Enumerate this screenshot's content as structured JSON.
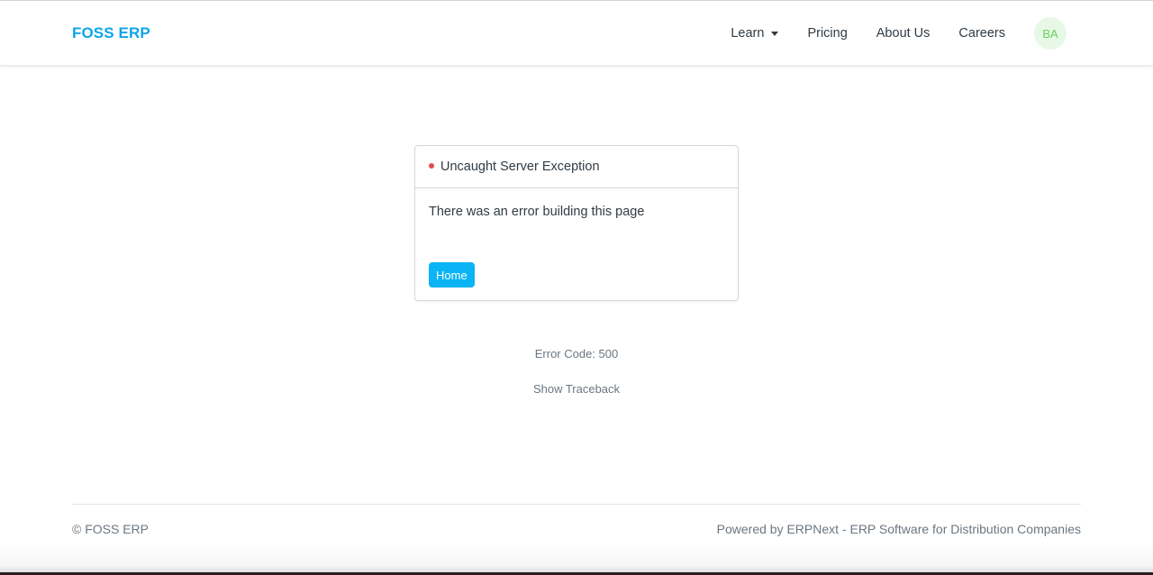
{
  "navbar": {
    "brand": "FOSS ERP",
    "links": [
      {
        "label": "Learn",
        "dropdown": true
      },
      {
        "label": "Pricing"
      },
      {
        "label": "About Us"
      },
      {
        "label": "Careers"
      }
    ],
    "avatar_initials": "BA"
  },
  "error_card": {
    "title": "Uncaught Server Exception",
    "message": "There was an error building this page",
    "home_button": "Home"
  },
  "error_code": "Error Code: 500",
  "show_traceback": "Show Traceback",
  "footer": {
    "copyright": "© FOSS ERP",
    "powered_by": "Powered by ERPNext - ERP Software for Distribution Companies"
  },
  "colors": {
    "brand": "#0ea5e9",
    "button": "#0ab4f5",
    "error_dot": "#e24c4c",
    "avatar_bg": "#e7f9e6",
    "avatar_text": "#68d058"
  }
}
